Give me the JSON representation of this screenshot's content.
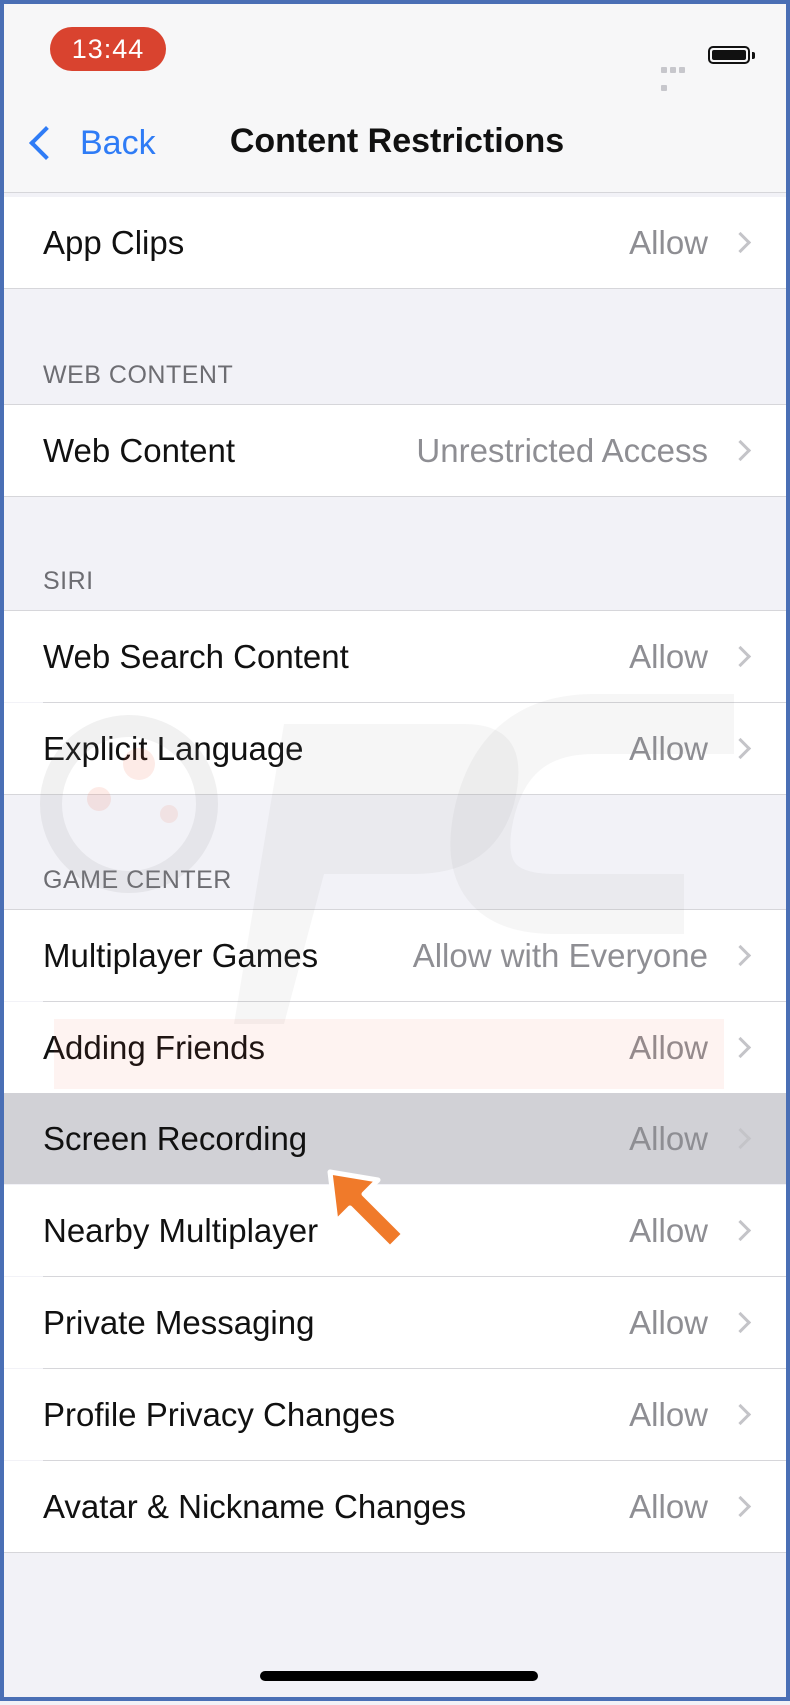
{
  "status_bar": {
    "time": "13:44"
  },
  "nav": {
    "back_label": "Back",
    "title": "Content Restrictions"
  },
  "rows": {
    "app_clips": {
      "label": "App Clips",
      "value": "Allow"
    },
    "web_content": {
      "label": "Web Content",
      "value": "Unrestricted Access"
    },
    "web_search_content": {
      "label": "Web Search Content",
      "value": "Allow"
    },
    "explicit_language": {
      "label": "Explicit Language",
      "value": "Allow"
    },
    "multiplayer_games": {
      "label": "Multiplayer Games",
      "value": "Allow with Everyone"
    },
    "adding_friends": {
      "label": "Adding Friends",
      "value": "Allow"
    },
    "screen_recording": {
      "label": "Screen Recording",
      "value": "Allow"
    },
    "nearby_multiplayer": {
      "label": "Nearby Multiplayer",
      "value": "Allow"
    },
    "private_messaging": {
      "label": "Private Messaging",
      "value": "Allow"
    },
    "profile_privacy_changes": {
      "label": "Profile Privacy Changes",
      "value": "Allow"
    },
    "avatar_nickname_changes": {
      "label": "Avatar & Nickname Changes",
      "value": "Allow"
    }
  },
  "sections": {
    "web_content": "WEB CONTENT",
    "siri": "SIRI",
    "game_center": "GAME CENTER"
  },
  "colors": {
    "accent": "#2f7cf6",
    "time_pill": "#d9432f",
    "highlight_row": "#d1d1d6",
    "pointer_arrow": "#f07a2a"
  }
}
